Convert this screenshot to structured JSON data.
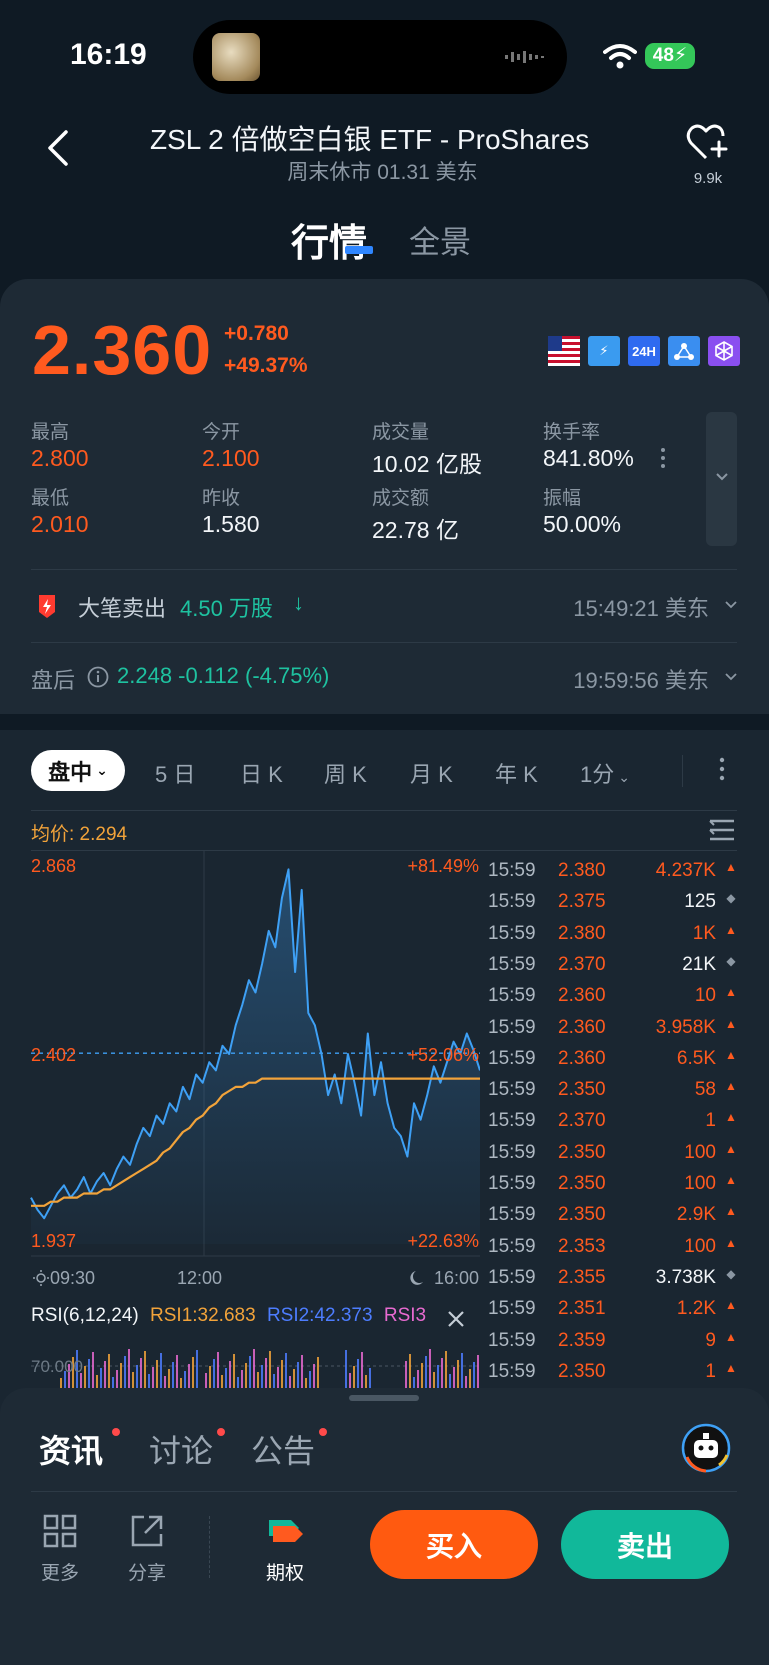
{
  "status": {
    "time": "16:19",
    "battery": "48"
  },
  "header": {
    "title": "ZSL 2 倍做空白银 ETF - ProShares",
    "subtitle": "周末休市 01.31 美东",
    "fav_count": "9.9k",
    "tabs": [
      "行情",
      "全景"
    ]
  },
  "quote": {
    "price": "2.360",
    "change": "+0.780",
    "change_pct": "+49.37%",
    "badges": [
      "24H"
    ],
    "stats": [
      {
        "label": "最高",
        "value": "2.800",
        "color": "red"
      },
      {
        "label": "今开",
        "value": "2.100",
        "color": "red"
      },
      {
        "label": "成交量",
        "value": "10.02 亿股",
        "color": "white"
      },
      {
        "label": "换手率",
        "value": "841.80%",
        "color": "white"
      },
      {
        "label": "最低",
        "value": "2.010",
        "color": "red"
      },
      {
        "label": "昨收",
        "value": "1.580",
        "color": "white"
      },
      {
        "label": "成交额",
        "value": "22.78 亿",
        "color": "white"
      },
      {
        "label": "振幅",
        "value": "50.00%",
        "color": "white"
      }
    ],
    "big_order": {
      "label": "大笔卖出",
      "amount": "4.50 万股",
      "time": "15:49:21 美东"
    },
    "after_hours": {
      "label": "盘后",
      "value": "2.248 -0.112 (-4.75%)",
      "time": "19:59:56 美东"
    }
  },
  "chart_controls": {
    "active": "盘中",
    "periods": [
      "5 日",
      "日 K",
      "周 K",
      "月 K",
      "年 K",
      "1分"
    ]
  },
  "chart_data": {
    "type": "line",
    "avg_label": "均价: 2.294",
    "y_left_labels": [
      "2.868",
      "2.402",
      "1.937"
    ],
    "y_right_labels": [
      "+81.49%",
      "+52.06%",
      "+22.63%"
    ],
    "x_labels": [
      "09:30",
      "12:00",
      "16:00"
    ],
    "ylim": [
      1.937,
      2.868
    ],
    "reference_price": 2.402,
    "series": [
      {
        "color": "#3ea0f5",
        "values": [
          2.05,
          2.02,
          2.0,
          2.03,
          2.06,
          2.08,
          2.05,
          2.07,
          2.1,
          2.06,
          2.09,
          2.11,
          2.08,
          2.12,
          2.15,
          2.13,
          2.18,
          2.22,
          2.2,
          2.25,
          2.23,
          2.28,
          2.26,
          2.32,
          2.29,
          2.35,
          2.33,
          2.38,
          2.36,
          2.42,
          2.4,
          2.47,
          2.52,
          2.58,
          2.55,
          2.62,
          2.7,
          2.66,
          2.78,
          2.85,
          2.6,
          2.8,
          2.5,
          2.47,
          2.4,
          2.3,
          2.35,
          2.28,
          2.4,
          2.33,
          2.25,
          2.45,
          2.3,
          2.38,
          2.28,
          2.22,
          2.2,
          2.15,
          2.28,
          2.24,
          2.3,
          2.37,
          2.33,
          2.38,
          2.43,
          2.4,
          2.45,
          2.41,
          2.36
        ]
      },
      {
        "color": "#f2a33a",
        "values": [
          2.03,
          2.03,
          2.03,
          2.04,
          2.04,
          2.05,
          2.05,
          2.05,
          2.06,
          2.06,
          2.06,
          2.07,
          2.07,
          2.08,
          2.09,
          2.1,
          2.11,
          2.12,
          2.13,
          2.14,
          2.16,
          2.17,
          2.19,
          2.21,
          2.22,
          2.24,
          2.25,
          2.27,
          2.28,
          2.3,
          2.31,
          2.32,
          2.32,
          2.33,
          2.33,
          2.34,
          2.34,
          2.34,
          2.34,
          2.34,
          2.34,
          2.34,
          2.34,
          2.34,
          2.34,
          2.34,
          2.34,
          2.34,
          2.34,
          2.34,
          2.34,
          2.34,
          2.34,
          2.34,
          2.34,
          2.34,
          2.34,
          2.34,
          2.34,
          2.34,
          2.34,
          2.34,
          2.34,
          2.34,
          2.34,
          2.34,
          2.34,
          2.34,
          2.34
        ]
      }
    ]
  },
  "trades": [
    {
      "time": "15:59",
      "price": "2.380",
      "vol": "4.237K",
      "dir": "up"
    },
    {
      "time": "15:59",
      "price": "2.375",
      "vol": "125",
      "dir": "flat"
    },
    {
      "time": "15:59",
      "price": "2.380",
      "vol": "1K",
      "dir": "up"
    },
    {
      "time": "15:59",
      "price": "2.370",
      "vol": "21K",
      "dir": "flat"
    },
    {
      "time": "15:59",
      "price": "2.360",
      "vol": "10",
      "dir": "up"
    },
    {
      "time": "15:59",
      "price": "2.360",
      "vol": "3.958K",
      "dir": "up"
    },
    {
      "time": "15:59",
      "price": "2.360",
      "vol": "6.5K",
      "dir": "up"
    },
    {
      "time": "15:59",
      "price": "2.350",
      "vol": "58",
      "dir": "up"
    },
    {
      "time": "15:59",
      "price": "2.370",
      "vol": "1",
      "dir": "up"
    },
    {
      "time": "15:59",
      "price": "2.350",
      "vol": "100",
      "dir": "up"
    },
    {
      "time": "15:59",
      "price": "2.350",
      "vol": "100",
      "dir": "up"
    },
    {
      "time": "15:59",
      "price": "2.350",
      "vol": "2.9K",
      "dir": "up"
    },
    {
      "time": "15:59",
      "price": "2.353",
      "vol": "100",
      "dir": "up"
    },
    {
      "time": "15:59",
      "price": "2.355",
      "vol": "3.738K",
      "dir": "flat"
    },
    {
      "time": "15:59",
      "price": "2.351",
      "vol": "1.2K",
      "dir": "up"
    },
    {
      "time": "15:59",
      "price": "2.359",
      "vol": "9",
      "dir": "up"
    },
    {
      "time": "15:59",
      "price": "2.350",
      "vol": "1",
      "dir": "up"
    }
  ],
  "rsi": {
    "title": "RSI(6,12,24)",
    "rsi1": "RSI1:32.683",
    "rsi2": "RSI2:42.373",
    "rsi3": "RSI3",
    "level_label": "70.000"
  },
  "sheet": {
    "tabs": [
      "资讯",
      "讨论",
      "公告"
    ],
    "actions": [
      "更多",
      "分享",
      "期权"
    ],
    "buy": "买入",
    "sell": "卖出"
  }
}
